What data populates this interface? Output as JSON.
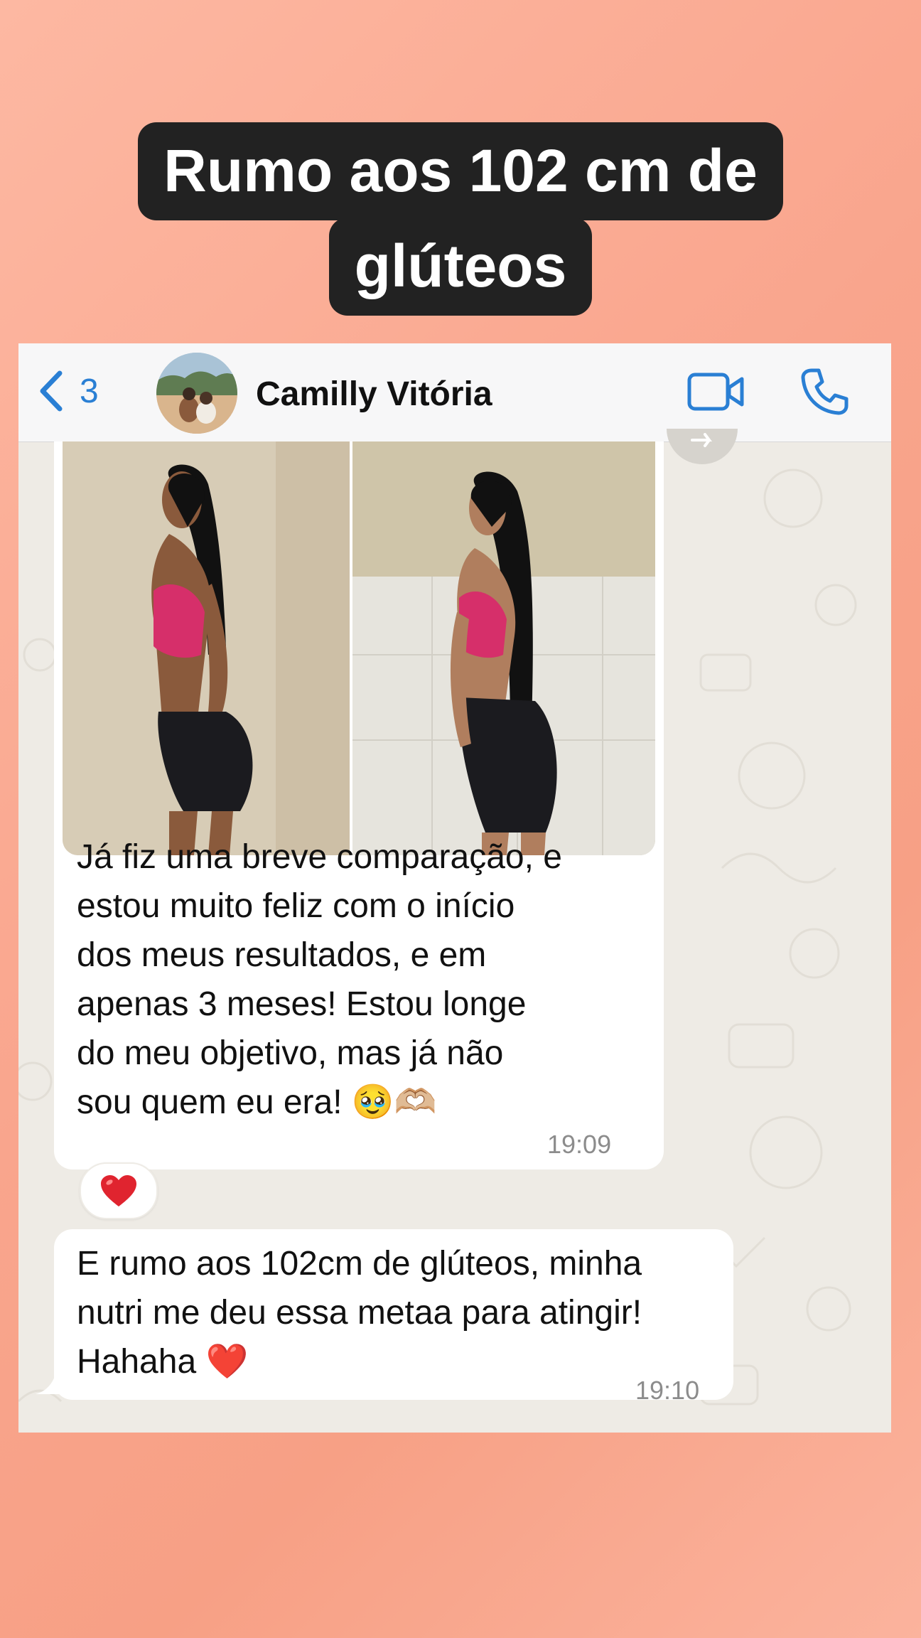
{
  "overlay": {
    "headline_line1": "Rumo aos 102 cm de",
    "headline_line2": "glúteos"
  },
  "header": {
    "back_count": "3",
    "contact_name": "Camilly Vitória",
    "icons": [
      "chevron-left-icon",
      "video-call-icon",
      "phone-icon"
    ],
    "accent_color": "#2a7fd4"
  },
  "messages": [
    {
      "type": "image_with_caption",
      "text": "Já fiz uma breve comparação, e\nestou muito feliz com o início\ndos meus resultados, e em\napenas 3 meses! Estou longe\ndo meu objetivo, mas já não\nsou quem eu era! 🥹🫶🏼",
      "time": "19:09",
      "reaction": "❤️"
    },
    {
      "type": "text",
      "text": "E rumo aos 102cm de glúteos, minha\nnutri me deu essa metaa para atingir!\nHahaha ❤️",
      "time": "19:10"
    }
  ]
}
